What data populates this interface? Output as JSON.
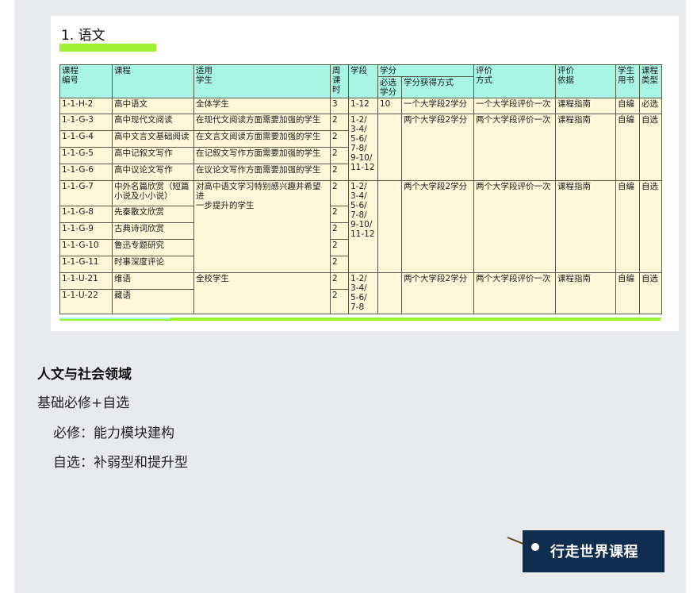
{
  "card": {
    "title": "1. 语文",
    "headers": {
      "code": "课程\n编号",
      "course": "课程",
      "audience": "适用\n学生",
      "hours": "周\n课\n时",
      "stage": "学段",
      "credits": "学分",
      "req_credits": "必选\n学分",
      "credit_method": "学分获得方式",
      "eval_method": "评价\n方式",
      "eval_basis": "评价\n依据",
      "books": "学生\n用书",
      "type": "课程\n类型"
    },
    "g1": {
      "code": "1-1-H-2",
      "course": "高中语文",
      "audience": "全体学生",
      "hours": "3",
      "stage": "1-12",
      "credits": "10",
      "credit_method": "一个大学段2学分",
      "eval_method": "一个大学段评价一次",
      "eval_basis": "课程指南",
      "books": "自编",
      "type": "必选"
    },
    "g2": {
      "rows": [
        {
          "code": "1-1-G-3",
          "course": "高中现代文阅读",
          "audience": "在现代文阅读方面需要加强的学生",
          "hours": "2"
        },
        {
          "code": "1-1-G-4",
          "course": "高中文言文基础阅读",
          "audience": "在文言文阅读方面需要加强的学生",
          "hours": "2"
        },
        {
          "code": "1-1-G-5",
          "course": "高中记叙文写作",
          "audience": "在记叙文写作方面需要加强的学生",
          "hours": "2"
        },
        {
          "code": "1-1-G-6",
          "course": "高中议论文写作",
          "audience": "在议论文写作方面需要加强的学生",
          "hours": "2"
        }
      ],
      "stage": "1-2/\n3-4/\n5-6/\n7-8/\n9-10/\n11-12",
      "credit_method": "两个大学段2学分",
      "eval_method": "两个大学段评价一次",
      "eval_basis": "课程指南",
      "books": "自编",
      "type": "自选"
    },
    "g3": {
      "rows": [
        {
          "code": "1-1-G-7",
          "course": "中外名篇欣赏（短篇\n小说及小小说）",
          "hours": "2"
        },
        {
          "code": "1-1-G-8",
          "course": "先秦散文欣赏",
          "hours": "2"
        },
        {
          "code": "1-1-G-9",
          "course": "古典诗词欣赏",
          "hours": "2"
        },
        {
          "code": "1-1-G-10",
          "course": "鲁迅专题研究",
          "hours": "2"
        },
        {
          "code": "1-1-G-11",
          "course": "时事深度评论",
          "hours": "2"
        }
      ],
      "audience": "对高中语文学习特别感兴趣并希望进\n一步提升的学生",
      "stage": "1-2/\n3-4/\n5-6/\n7-8/\n9-10/\n11-12",
      "credit_method": "两个大学段2学分",
      "eval_method": "两个大学段评价一次",
      "eval_basis": "课程指南",
      "books": "自编",
      "type": "自选"
    },
    "g4": {
      "rows": [
        {
          "code": "1-1-U-21",
          "course": "维语",
          "hours": "2"
        },
        {
          "code": "1-1-U-22",
          "course": "藏语",
          "hours": "2"
        }
      ],
      "audience": "全校学生",
      "stage": "1-2/\n3-4/\n5-6/\n7-8",
      "credit_method": "两个大学段2学分",
      "eval_method": "两个大学段评价一次",
      "eval_basis": "课程指南",
      "books": "自编",
      "type": "自选"
    }
  },
  "body": {
    "heading": "人文与社会领域",
    "line1": "基础必修+自选",
    "line2": "必修：能力模块建构",
    "line3": "自选：补弱型和提升型"
  },
  "tag": {
    "label": "行走世界课程"
  }
}
